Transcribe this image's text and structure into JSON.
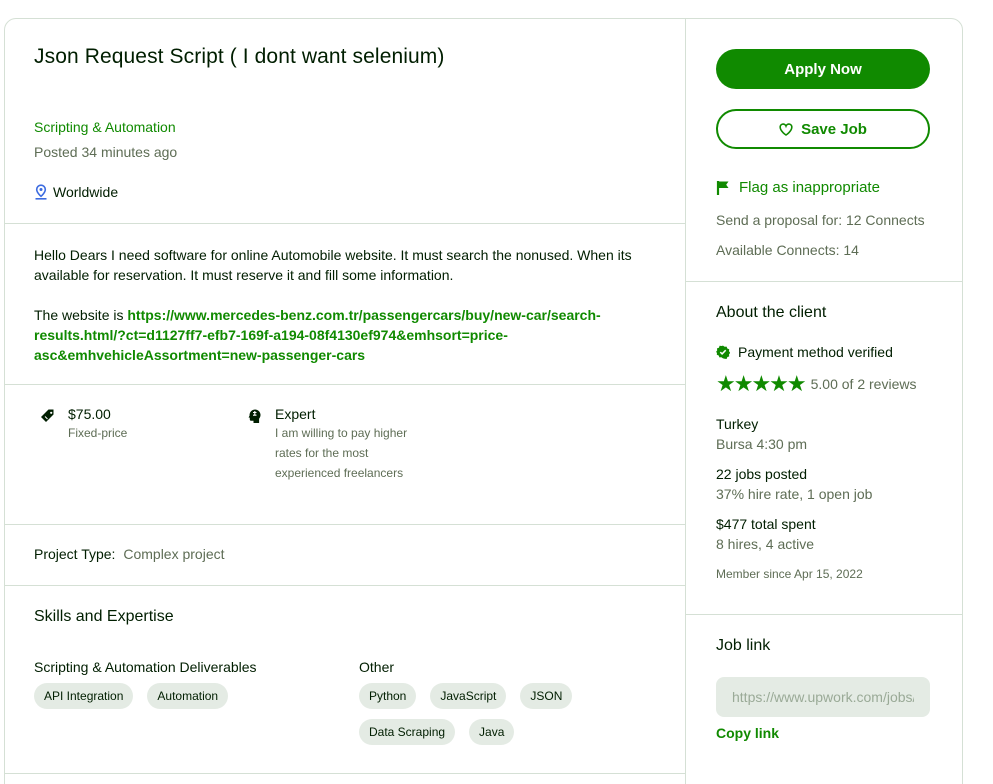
{
  "job": {
    "title": "Json Request Script ( I dont want selenium)",
    "category": "Scripting & Automation",
    "posted": "Posted 34 minutes ago",
    "location": "Worldwide",
    "description_1": "Hello Dears I need software for online Automobile website. It must search the nonused. When its available for reservation. It must reserve it and fill some information.",
    "description_2_prefix": "The website is ",
    "description_2_link": "https://www.mercedes-benz.com.tr/passengercars/buy/new-car/search-results.html/?ct=d1127ff7-efb7-169f-a194-08f4130ef974&emhsort=price-asc&emhvehicleAssortment=new-passenger-cars",
    "price": "$75.00",
    "price_type": "Fixed-price",
    "level": "Expert",
    "level_desc": "I am willing to pay higher rates for the most experienced freelancers",
    "project_type_label": "Project Type:",
    "project_type_value": "Complex project"
  },
  "skills": {
    "heading": "Skills and Expertise",
    "groups": [
      {
        "name": "Scripting & Automation Deliverables",
        "chips": [
          "API Integration",
          "Automation"
        ]
      },
      {
        "name": "Other",
        "chips": [
          "Python",
          "JavaScript",
          "JSON",
          "Data Scraping",
          "Java"
        ]
      }
    ]
  },
  "sidebar": {
    "apply_label": "Apply Now",
    "save_label": "Save Job",
    "flag_label": "Flag as inappropriate",
    "proposal_connects": "Send a proposal for: 12 Connects",
    "available_connects": "Available Connects: 14"
  },
  "client": {
    "heading": "About the client",
    "payment": "Payment method verified",
    "stars": "★★★★★",
    "rating_text": "5.00 of 2 reviews",
    "country": "Turkey",
    "city_time": "Bursa 4:30 pm",
    "jobs_posted": "22 jobs posted",
    "hire_rate": "37% hire rate, 1 open job",
    "total_spent": "$477 total spent",
    "hires": "8 hires, 4 active",
    "member_since": "Member since Apr 15, 2022"
  },
  "job_link": {
    "heading": "Job link",
    "url": "https://www.upwork.com/jobs/",
    "copy_label": "Copy link"
  },
  "colors": {
    "accent": "#108a00",
    "text": "#001e00",
    "muted": "#5e6d55",
    "chip_bg": "#e4ebe4",
    "border": "#d5e0d5"
  }
}
